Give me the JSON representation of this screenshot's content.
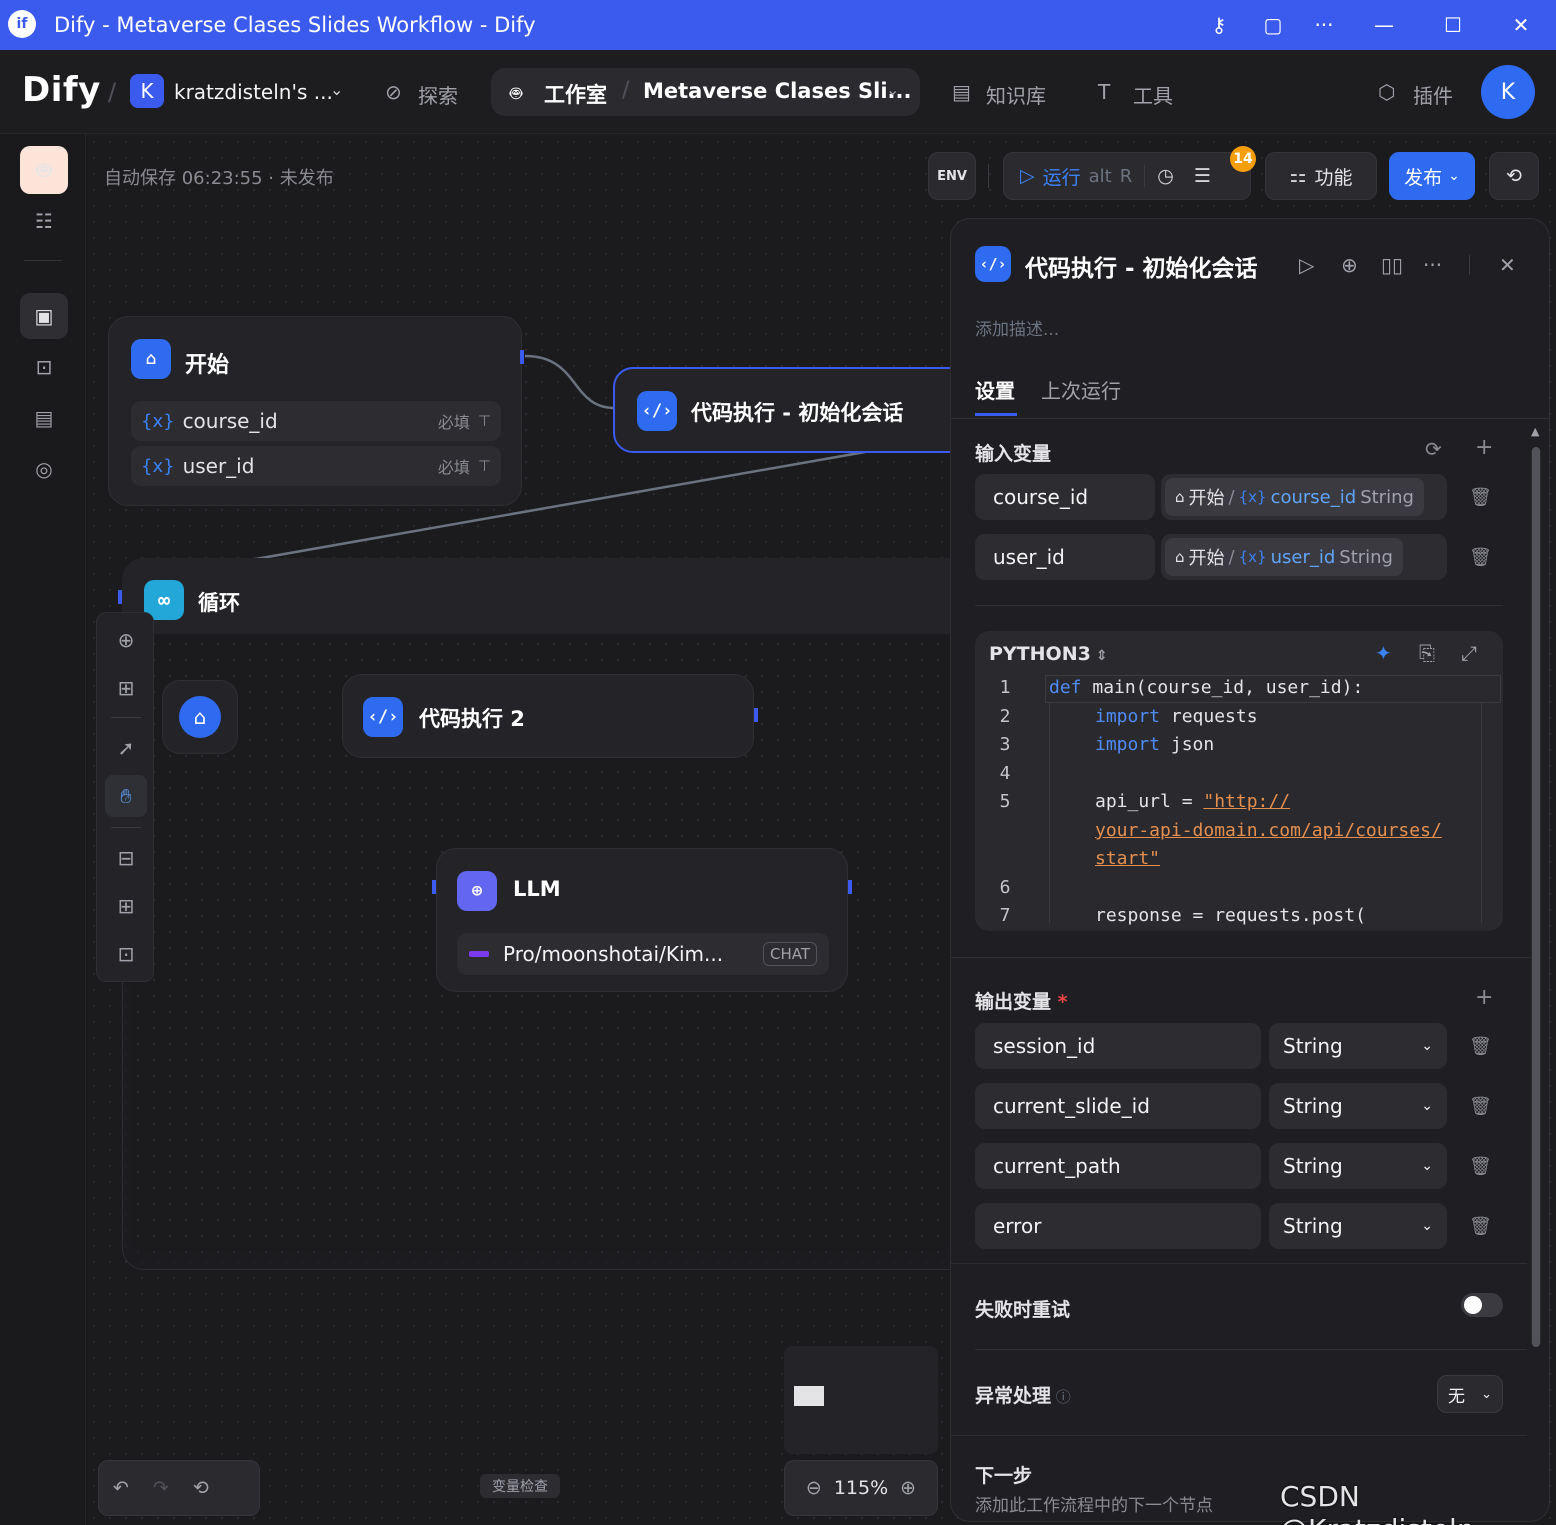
{
  "window": {
    "title": "Dify - Metaverse Clases Slides Workflow - Dify"
  },
  "header": {
    "logo": "Dify",
    "workspace_initial": "K",
    "workspace": "kratzdisteln's ...",
    "explore": "探索",
    "studio": "工作室",
    "app_name": "Metaverse Clases Sli...",
    "knowledge": "知识库",
    "tools": "工具",
    "plugins": "插件",
    "user_initial": "K"
  },
  "status": {
    "autosave": "自动保存 06:23:55 · 未发布"
  },
  "actions": {
    "env": "ENV",
    "run": "运行",
    "run_shortcut": "alt",
    "run_key": "R",
    "checklist_count": "14",
    "features": "功能",
    "publish": "发布"
  },
  "canvas": {
    "start": {
      "title": "开始",
      "vars": [
        {
          "name": "course_id",
          "required": "必填"
        },
        {
          "name": "user_id",
          "required": "必填"
        }
      ]
    },
    "code_init": {
      "title": "代码执行 - 初始化会话"
    },
    "loop": {
      "title": "循环"
    },
    "code2": {
      "title": "代码执行 2"
    },
    "llm": {
      "title": "LLM",
      "model": "Pro/moonshotai/Kim...",
      "mode": "CHAT"
    },
    "var_inspect": "变量检查",
    "zoom": "115%"
  },
  "panel": {
    "title": "代码执行 - 初始化会话",
    "desc_placeholder": "添加描述...",
    "tabs": [
      "设置",
      "上次运行"
    ],
    "input_label": "输入变量",
    "inputs": [
      {
        "name": "course_id",
        "src_node": "开始",
        "src_var": "course_id",
        "type": "String"
      },
      {
        "name": "user_id",
        "src_node": "开始",
        "src_var": "user_id",
        "type": "String"
      }
    ],
    "lang": "PYTHON3",
    "code": {
      "l1a": "def",
      "l1b": " main(course_id, user_id):",
      "l2a": "import",
      "l2b": " requests",
      "l3a": "import",
      "l3b": " json",
      "l5a": "api_url = ",
      "l5b": "\"http://",
      "l5c": "your-api-domain.com/api/courses/",
      "l5d": "start\"",
      "l7": "response = requests.post("
    },
    "output_label": "输出变量",
    "outputs": [
      {
        "name": "session_id",
        "type": "String"
      },
      {
        "name": "current_slide_id",
        "type": "String"
      },
      {
        "name": "current_path",
        "type": "String"
      },
      {
        "name": "error",
        "type": "String"
      }
    ],
    "retry_label": "失败时重试",
    "error_label": "异常处理",
    "error_value": "无",
    "next_label": "下一步",
    "next_desc": "添加此工作流程中的下一个节点"
  },
  "watermark": "CSDN @Kratzdisteln"
}
